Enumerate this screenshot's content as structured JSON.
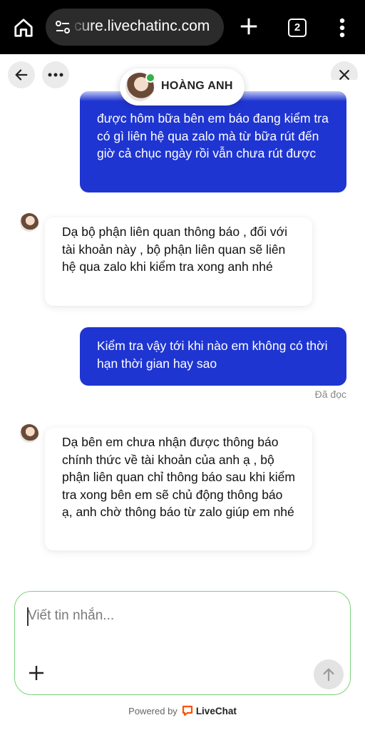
{
  "browser": {
    "url": "cure.livechatinc.com",
    "tab_count": "2"
  },
  "header": {
    "agent_name": "HOÀNG ANH"
  },
  "messages": [
    {
      "from": "visitor",
      "text": "được hôm bữa bên em báo đang kiểm tra có gì liên hệ qua zalo mà từ bữa rút đến giờ cả chục ngày rồi vẫn chưa rút được"
    },
    {
      "from": "agent",
      "text": "Dạ bộ phận liên quan thông báo , đối với tài khoản này , bộ phận liên quan sẽ liên hệ qua zalo khi kiểm tra xong anh nhé"
    },
    {
      "from": "visitor",
      "text": "Kiểm tra vậy tới khi nào em không có thời hạn thời gian hay sao"
    },
    {
      "from": "agent",
      "text": "Dạ bên em chưa nhận được thông báo chính thức về tài khoản của anh ạ , bộ phận liên quan chỉ thông báo sau khi kiểm tra xong bên em sẽ chủ động thông báo ạ, anh chờ thông báo từ zalo giúp em nhé"
    }
  ],
  "read_status": "Đã đọc",
  "composer": {
    "placeholder": "Viết tin nhắn..."
  },
  "footer": {
    "powered_by": "Powered by",
    "brand": "LiveChat"
  },
  "colors": {
    "visitor_bubble": "#1f35d1",
    "composer_border": "#7bd27c",
    "brand_orange": "#ff5100",
    "online": "#2fb34a"
  }
}
